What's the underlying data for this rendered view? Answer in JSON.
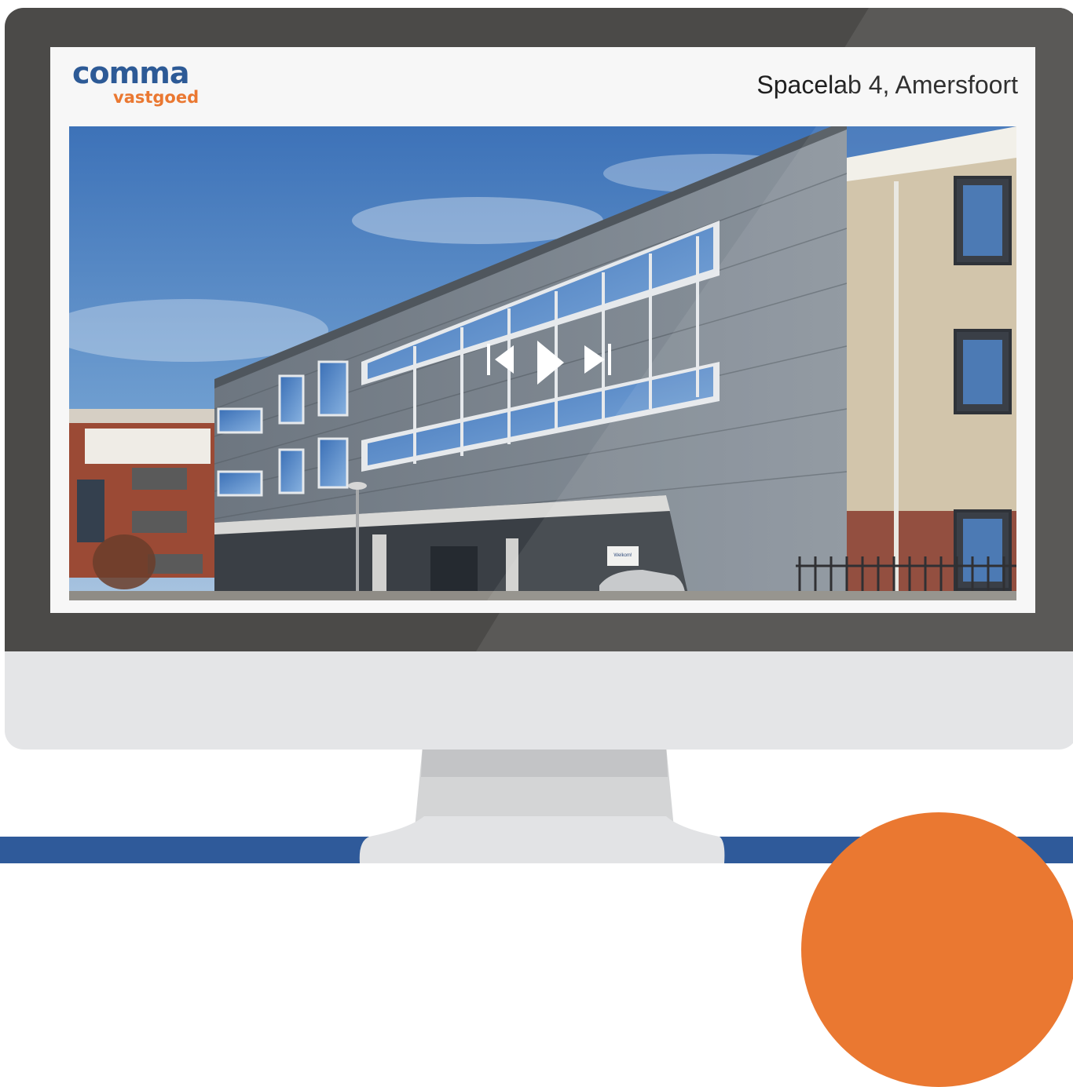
{
  "brand": {
    "name": "comma",
    "tagline": "vastgoed",
    "primary_color": "#2d5a96",
    "accent_color": "#ea7831"
  },
  "listing": {
    "title": "Spacelab 4, Amersfoort"
  },
  "slideshow": {
    "controls": [
      {
        "name": "previous",
        "icon": "skip-previous-icon"
      },
      {
        "name": "play",
        "icon": "play-icon"
      },
      {
        "name": "next",
        "icon": "skip-next-icon"
      }
    ],
    "sign_text": "Welkom!"
  }
}
